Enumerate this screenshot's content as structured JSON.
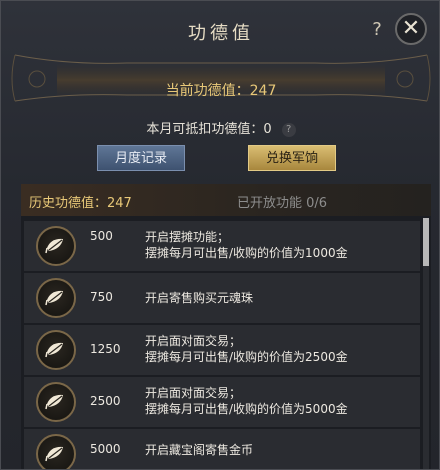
{
  "header": {
    "title": "功德值",
    "help_glyph": "?",
    "close_glyph": "✕"
  },
  "current_value_label": "当前功德值：247",
  "monthly_deduct_label": "本月可抵扣功德值：0",
  "monthly_deduct_help": "?",
  "buttons": {
    "monthly_record": "月度记录",
    "exchange": "兑换军饷"
  },
  "list_header": {
    "history": "历史功德值：247",
    "opened": "已开放功能 0/6"
  },
  "rows": [
    {
      "requirement": "500",
      "line1": "开启摆摊功能；",
      "line2": "摆摊每月可出售/收购的价值为1000金",
      "icon": "leaf-coin-icon"
    },
    {
      "requirement": "750",
      "line1": "开启寄售购买元魂珠",
      "line2": "",
      "icon": "leaf-coin-icon"
    },
    {
      "requirement": "1250",
      "line1": "开启面对面交易；",
      "line2": "摆摊每月可出售/收购的价值为2500金",
      "icon": "leaf-coin-icon"
    },
    {
      "requirement": "2500",
      "line1": "开启面对面交易；",
      "line2": "摆摊每月可出售/收购的价值为5000金",
      "icon": "leaf-coin-icon"
    },
    {
      "requirement": "5000",
      "line1": "开启藏宝阁寄售金币",
      "line2": "",
      "icon": "leaf-coin-icon"
    }
  ],
  "colors": {
    "gold_text": "#e8c878",
    "monthly_button": "#4f6584",
    "exchange_button": "#c3a455"
  }
}
